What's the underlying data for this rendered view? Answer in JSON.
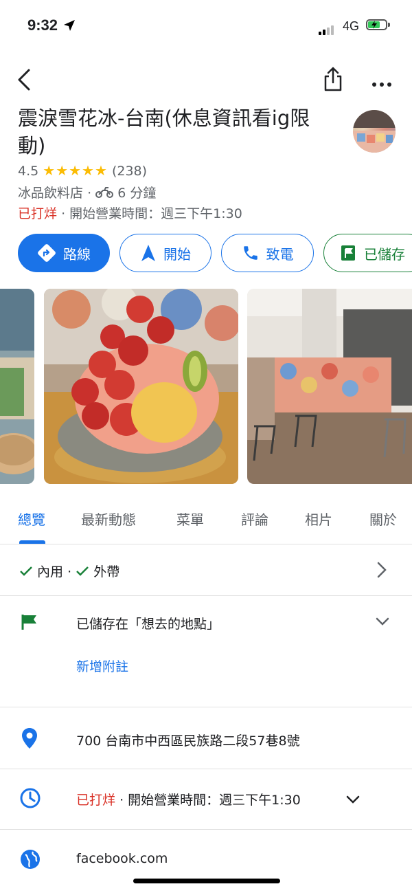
{
  "status_bar": {
    "time": "9:32",
    "network": "4G"
  },
  "place": {
    "title": "震淚雪花冰-台南(休息資訊看ig限動)",
    "rating": "4.5",
    "stars": "★★★★★",
    "review_count": "(238)",
    "category": "冰品飲料店",
    "travel_time": "6 分鐘",
    "closed_label": "已打烊",
    "opening_text": "開始營業時間：週三下午1:30"
  },
  "actions": {
    "directions": "路線",
    "start": "開始",
    "call": "致電",
    "saved": "已儲存"
  },
  "tabs": [
    "總覽",
    "最新動態",
    "菜單",
    "評論",
    "相片",
    "關於"
  ],
  "services": {
    "dine_in": "內用",
    "takeout": "外帶"
  },
  "saved_list": {
    "text": "已儲存在「想去的地點」",
    "add_note": "新增附註"
  },
  "address": "700 台南市中西區民族路二段57巷8號",
  "hours": {
    "closed": "已打烊",
    "opening": "開始營業時間：週三下午1:30"
  },
  "website": "facebook.com",
  "colors": {
    "accent": "#1a73e8",
    "closed": "#d93025",
    "saved": "#188038",
    "star": "#fbbc04"
  }
}
